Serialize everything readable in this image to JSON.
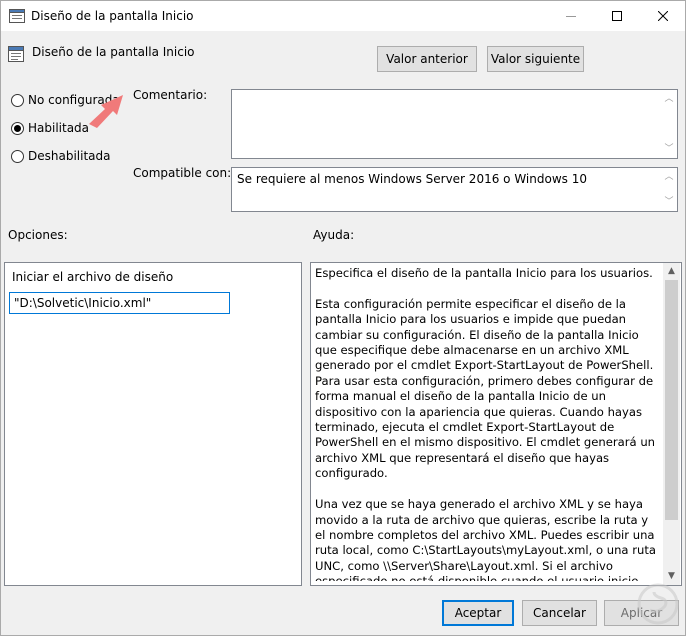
{
  "window": {
    "title": "Diseño de la pantalla Inicio"
  },
  "header": {
    "policy_title": "Diseño de la pantalla Inicio",
    "prev_button": "Valor anterior",
    "next_button": "Valor siguiente"
  },
  "state": {
    "options": [
      {
        "label": "No configurada",
        "checked": false
      },
      {
        "label": "Habilitada",
        "checked": true
      },
      {
        "label": "Deshabilitada",
        "checked": false
      }
    ]
  },
  "comment": {
    "label": "Comentario:",
    "value": ""
  },
  "compatible": {
    "label": "Compatible con:",
    "value": "Se requiere al menos Windows Server 2016 o Windows 10"
  },
  "options_section": {
    "heading": "Opciones:",
    "field_label": "Iniciar el archivo de diseño",
    "field_value": "\"D:\\Solvetic\\Inicio.xml\""
  },
  "help_section": {
    "heading": "Ayuda:",
    "text": "Especifica el diseño de la pantalla Inicio para los usuarios.\n\nEsta configuración permite especificar el diseño de la pantalla Inicio para los usuarios e impide que puedan cambiar su configuración. El diseño de la pantalla Inicio que especifique debe almacenarse en un archivo XML generado por el cmdlet Export-StartLayout de PowerShell.\nPara usar esta configuración, primero debes configurar de forma manual el diseño de la pantalla Inicio de un dispositivo con la apariencia que quieras. Cuando hayas terminado, ejecuta el cmdlet Export-StartLayout de PowerShell en el mismo dispositivo. El cmdlet generará un archivo XML que representará el diseño que hayas configurado.\n\nUna vez que se haya generado el archivo XML y se haya movido a la ruta de archivo que quieras, escribe la ruta y el nombre completos del archivo XML. Puedes escribir una ruta local, como C:\\StartLayouts\\myLayout.xml, o una ruta UNC, como \\\\Server\\Share\\Layout.xml. Si el archivo especificado no está disponible cuando el usuario inicie sesión, no se cambiará el diseño. Los usuarios no podrán personalizar su pantalla Inicio si esta"
  },
  "footer": {
    "accept": "Aceptar",
    "cancel": "Cancelar",
    "apply": "Aplicar"
  },
  "colors": {
    "annotation_arrow": "#f07a7a",
    "focus_border": "#0078d7"
  }
}
